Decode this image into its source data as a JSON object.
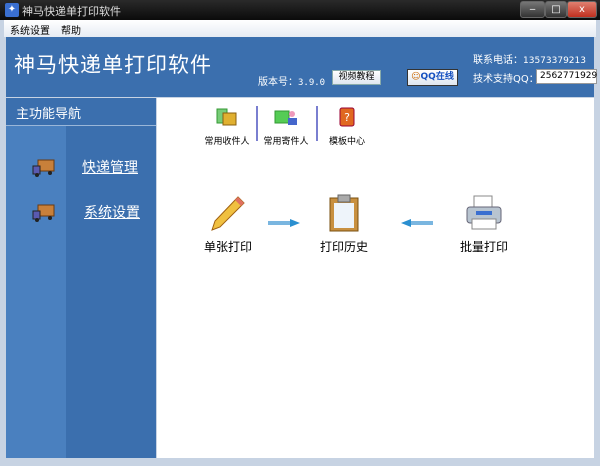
{
  "window": {
    "title": "神马快递单打印软件",
    "minimize": "‒",
    "maximize": "□",
    "close": "x"
  },
  "menu": [
    "系统设置",
    "帮助"
  ],
  "header": {
    "app_title": "神马快递单打印软件",
    "version_label": "版本号：",
    "version": "3.9.0",
    "video_button": "视频教程",
    "qq_button": "QQ在线",
    "phone_label": "联系电话：",
    "phone": "13573379213",
    "qq_label": "技术支持QQ：",
    "qq": "2562771929"
  },
  "sidebar": {
    "title": "主功能导航",
    "items": [
      {
        "label": "快递管理"
      },
      {
        "label": "系统设置"
      }
    ]
  },
  "toolbar": [
    {
      "label": "常用收件人"
    },
    {
      "label": "常用寄件人"
    },
    {
      "label": "模板中心"
    }
  ],
  "flow": [
    {
      "label": "单张打印"
    },
    {
      "label": "打印历史"
    },
    {
      "label": "批量打印"
    }
  ],
  "colors": {
    "header": "#3b6fae",
    "arrow": "#2a8fd0"
  }
}
